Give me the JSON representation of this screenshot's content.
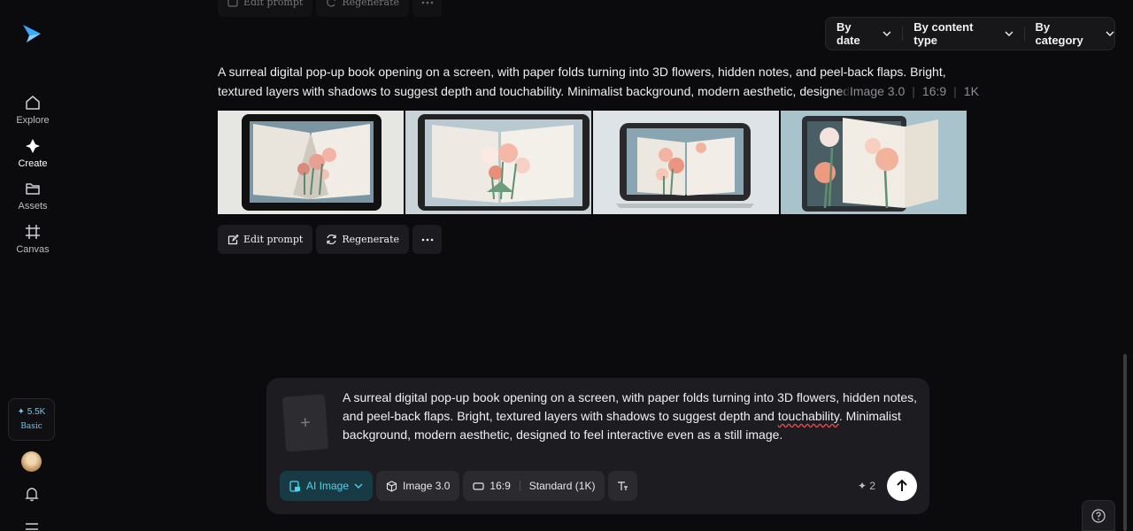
{
  "sidebar": {
    "items": [
      {
        "label": "Explore",
        "icon": "home-icon"
      },
      {
        "label": "Create",
        "icon": "sparkle-icon"
      },
      {
        "label": "Assets",
        "icon": "folder-icon"
      },
      {
        "label": "Canvas",
        "icon": "frame-icon"
      }
    ],
    "credits": {
      "amount": "✦ 5.5K",
      "plan": "Basic"
    }
  },
  "filters": {
    "by_date": "By date",
    "by_content_type": "By content type",
    "by_category": "By category"
  },
  "generation": {
    "prompt": "A surreal digital pop-up book opening on a screen, with paper folds turning into 3D flowers, hidden notes, and peel-back flaps. Bright, textured layers with shadows to suggest depth and touchability. Minimalist background, modern aesthetic, designed",
    "model": "Image 3.0",
    "ratio": "16:9",
    "resolution": "1K",
    "actions": {
      "edit": "Edit prompt",
      "regenerate": "Regenerate"
    }
  },
  "composer": {
    "text_before": "A surreal digital pop-up book opening on a screen, with paper folds turning into 3D flowers, hidden notes, and peel-back flaps. Bright, textured layers with shadows to suggest depth and ",
    "text_misspelled": "touchability",
    "text_after": ". Minimalist background, modern aesthetic, designed to feel interactive even as a still image.",
    "mode": "AI Image",
    "model": "Image 3.0",
    "ratio": "16:9",
    "quality": "Standard (1K)",
    "cost": "✦ 2"
  },
  "colors": {
    "accent": "#4fd3e8",
    "background": "#0b0b0d"
  }
}
